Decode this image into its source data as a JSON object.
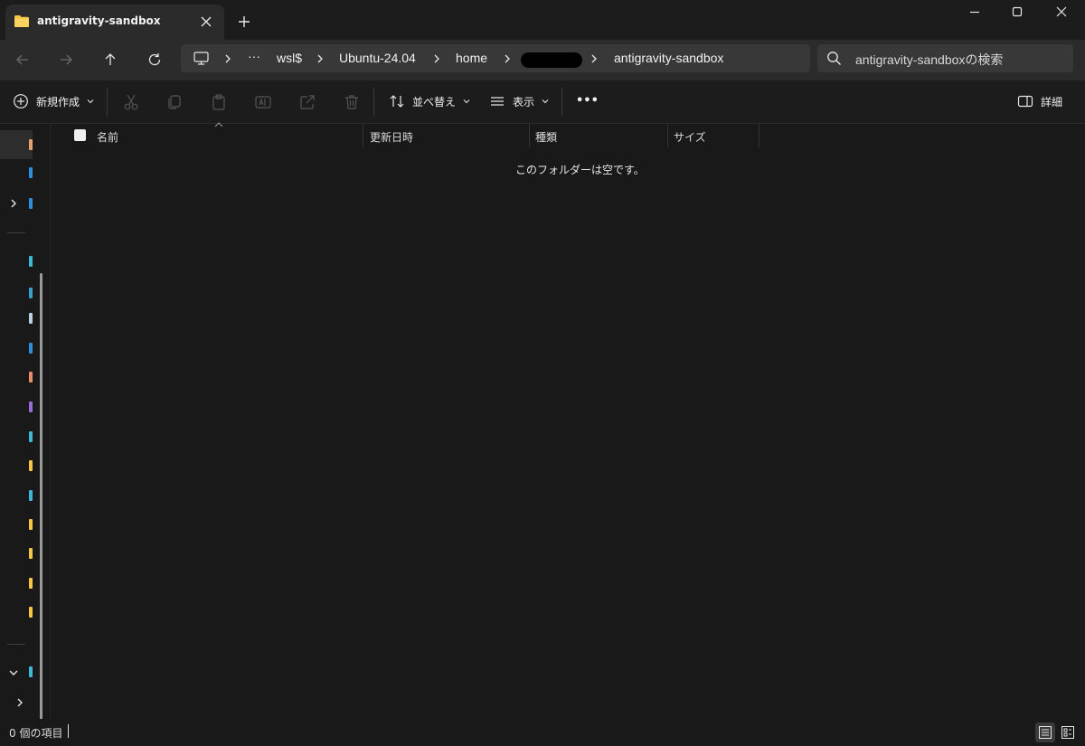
{
  "tab": {
    "title": "antigravity-sandbox",
    "folder_icon": "folder-icon",
    "accent": "#f6c546"
  },
  "breadcrumb": {
    "overflow": "···",
    "items": [
      "wsl$",
      "Ubuntu-24.04",
      "home",
      "antigravity-sandbox"
    ]
  },
  "search": {
    "placeholder": "antigravity-sandboxの検索"
  },
  "toolbar": {
    "new_label": "新規作成",
    "sort_label": "並べ替え",
    "view_label": "表示",
    "more_label": "•••",
    "details_label": "詳細"
  },
  "columns": [
    "名前",
    "更新日時",
    "種類",
    "サイズ"
  ],
  "empty_message": "このフォルダーは空です。",
  "status": {
    "item_count": "0 個の項目"
  },
  "nav_marks": [
    {
      "color": "#e8a070"
    },
    {
      "color": "#2d8fe0"
    },
    {
      "color": "#2d8fe0"
    },
    {
      "color": "#3fb8d8"
    },
    {
      "color": "#3aa0d0"
    },
    {
      "color": "#b8d0e8"
    },
    {
      "color": "#2d8fe0"
    },
    {
      "color": "#e88c6a"
    },
    {
      "color": "#9a6ad8"
    },
    {
      "color": "#3fb8d8"
    },
    {
      "color": "#f6c546"
    },
    {
      "color": "#3fb8d8"
    },
    {
      "color": "#f6c546"
    },
    {
      "color": "#f6c546"
    },
    {
      "color": "#f6c546"
    },
    {
      "color": "#f6c546"
    },
    {
      "color": "#3fb8d8"
    }
  ]
}
